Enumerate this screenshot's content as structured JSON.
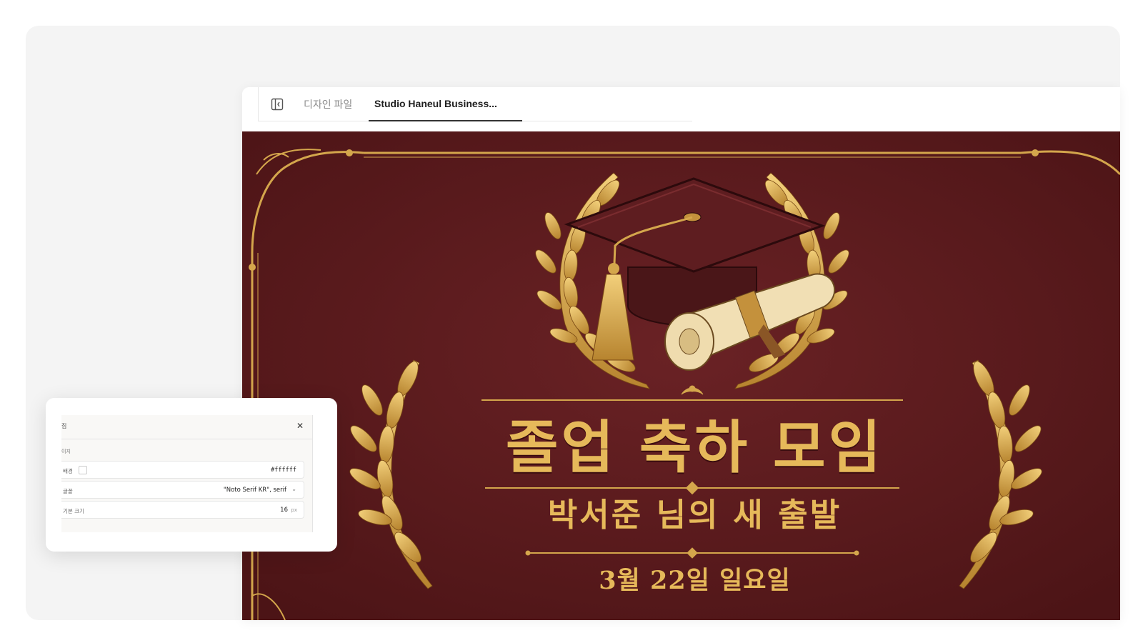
{
  "tabs": [
    {
      "label": "디자인 파일",
      "active": false
    },
    {
      "label": "Studio Haneul Business...",
      "active": true
    }
  ],
  "poster": {
    "title": "졸업 축하 모임",
    "subtitle": "박서준 님의 새 출발",
    "date": "3월 22일 일요일",
    "background_color": "#5b1a1d",
    "accent_color": "#e6b95a"
  },
  "settings_panel": {
    "title": "집",
    "section_label": "이지",
    "rows": [
      {
        "label": "배경",
        "value": "#ffffff"
      },
      {
        "label": "글꼴",
        "value": "\"Noto Serif KR\", serif"
      },
      {
        "label": "기본 크기",
        "value": "16",
        "unit": "px"
      }
    ]
  },
  "icons": {
    "sidebar_toggle": "sidebar-collapse-icon",
    "close": "close-icon",
    "dropdown": "chevron-down-icon"
  }
}
